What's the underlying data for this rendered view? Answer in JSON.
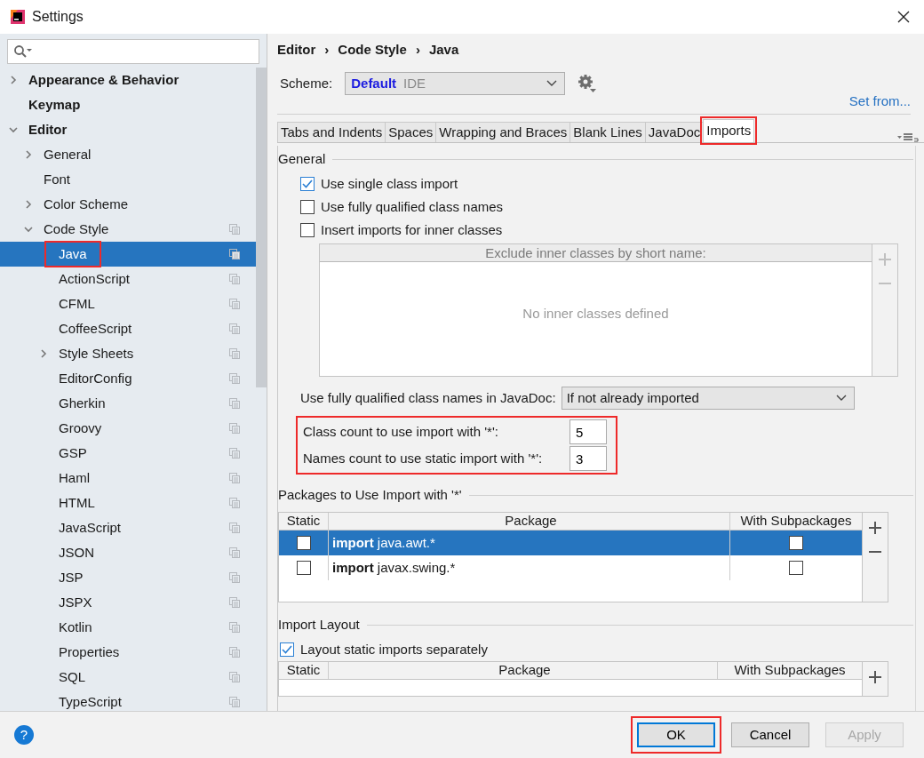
{
  "window": {
    "title": "Settings"
  },
  "sidebar": {
    "items": [
      {
        "label": "Appearance & Behavior",
        "bold": true,
        "expanded": false,
        "selected": false
      },
      {
        "label": "Keymap",
        "bold": true,
        "selected": false
      },
      {
        "label": "Editor",
        "bold": true,
        "expanded": true,
        "selected": false,
        "children": [
          {
            "label": "General",
            "expanded": false,
            "selected": false
          },
          {
            "label": "Font",
            "selected": false
          },
          {
            "label": "Color Scheme",
            "expanded": false,
            "selected": false
          },
          {
            "label": "Code Style",
            "expanded": true,
            "copy_icon": true,
            "selected": false,
            "children": [
              {
                "label": "Java",
                "copy_icon": true,
                "selected": true,
                "highlighted": true
              },
              {
                "label": "ActionScript",
                "copy_icon": true,
                "selected": false
              },
              {
                "label": "CFML",
                "copy_icon": true,
                "selected": false
              },
              {
                "label": "CoffeeScript",
                "copy_icon": true,
                "selected": false
              },
              {
                "label": "Style Sheets",
                "expanded": false,
                "copy_icon": true,
                "selected": false
              },
              {
                "label": "EditorConfig",
                "copy_icon": true,
                "selected": false
              },
              {
                "label": "Gherkin",
                "copy_icon": true,
                "selected": false
              },
              {
                "label": "Groovy",
                "copy_icon": true,
                "selected": false
              },
              {
                "label": "GSP",
                "copy_icon": true,
                "selected": false
              },
              {
                "label": "Haml",
                "copy_icon": true,
                "selected": false
              },
              {
                "label": "HTML",
                "copy_icon": true,
                "selected": false
              },
              {
                "label": "JavaScript",
                "copy_icon": true,
                "selected": false
              },
              {
                "label": "JSON",
                "copy_icon": true,
                "selected": false
              },
              {
                "label": "JSP",
                "copy_icon": true,
                "selected": false
              },
              {
                "label": "JSPX",
                "copy_icon": true,
                "selected": false
              },
              {
                "label": "Kotlin",
                "copy_icon": true,
                "selected": false
              },
              {
                "label": "Properties",
                "copy_icon": true,
                "selected": false
              },
              {
                "label": "SQL",
                "copy_icon": true,
                "selected": false
              },
              {
                "label": "TypeScript",
                "copy_icon": true,
                "selected": false
              }
            ]
          }
        ]
      }
    ]
  },
  "breadcrumb": [
    {
      "label": "Editor"
    },
    {
      "separator": "›",
      "label": "Code Style"
    },
    {
      "separator": "›",
      "label": "Java"
    }
  ],
  "scheme": {
    "label": "Scheme:",
    "value": "Default",
    "suffix": "IDE"
  },
  "set_from": "Set from...",
  "tabs": [
    {
      "label": "Tabs and Indents",
      "selected": false,
      "highlighted": false
    },
    {
      "label": "Spaces",
      "selected": false,
      "highlighted": false
    },
    {
      "label": "Wrapping and Braces",
      "selected": false,
      "highlighted": false
    },
    {
      "label": "Blank Lines",
      "selected": false,
      "highlighted": false
    },
    {
      "label": "JavaDoc",
      "selected": false,
      "highlighted": false
    },
    {
      "label": "Imports",
      "selected": true,
      "highlighted": true
    }
  ],
  "general": {
    "title": "General",
    "checkboxes": [
      {
        "label": "Use single class import",
        "checked": true
      },
      {
        "label": "Use fully qualified class names",
        "checked": false
      },
      {
        "label": "Insert imports for inner classes",
        "checked": false
      }
    ],
    "exclude_table": {
      "header": "Exclude inner classes by short name:",
      "empty_text": "No inner classes defined"
    },
    "javadoc": {
      "label": "Use fully qualified class names in JavaDoc:",
      "value": "If not already imported"
    },
    "counts_highlighted": true,
    "counts": [
      {
        "label": "Class count to use import with '*':",
        "value": "5"
      },
      {
        "label": "Names count to use static import with '*':",
        "value": "3"
      }
    ]
  },
  "packages": {
    "title": "Packages to Use Import with '*'",
    "columns": [
      "Static",
      "Package",
      "With Subpackages"
    ],
    "rows": [
      {
        "static": false,
        "package": "**import** java.awt.*",
        "with_subpackages": false,
        "selected": true
      },
      {
        "static": false,
        "package": "**import** javax.swing.*",
        "with_subpackages": false,
        "selected": false
      }
    ]
  },
  "import_layout": {
    "title": "Import Layout",
    "checkbox": {
      "label": "Layout static imports separately",
      "checked": true
    },
    "columns": [
      "Static",
      "Package",
      "With Subpackages"
    ]
  },
  "help_glyph": "?",
  "buttons": [
    {
      "label": "OK",
      "kind": "default",
      "highlighted": true,
      "disabled": false
    },
    {
      "label": "Cancel",
      "kind": "normal",
      "highlighted": false,
      "disabled": false
    },
    {
      "label": "Apply",
      "kind": "normal",
      "highlighted": false,
      "disabled": true
    }
  ]
}
